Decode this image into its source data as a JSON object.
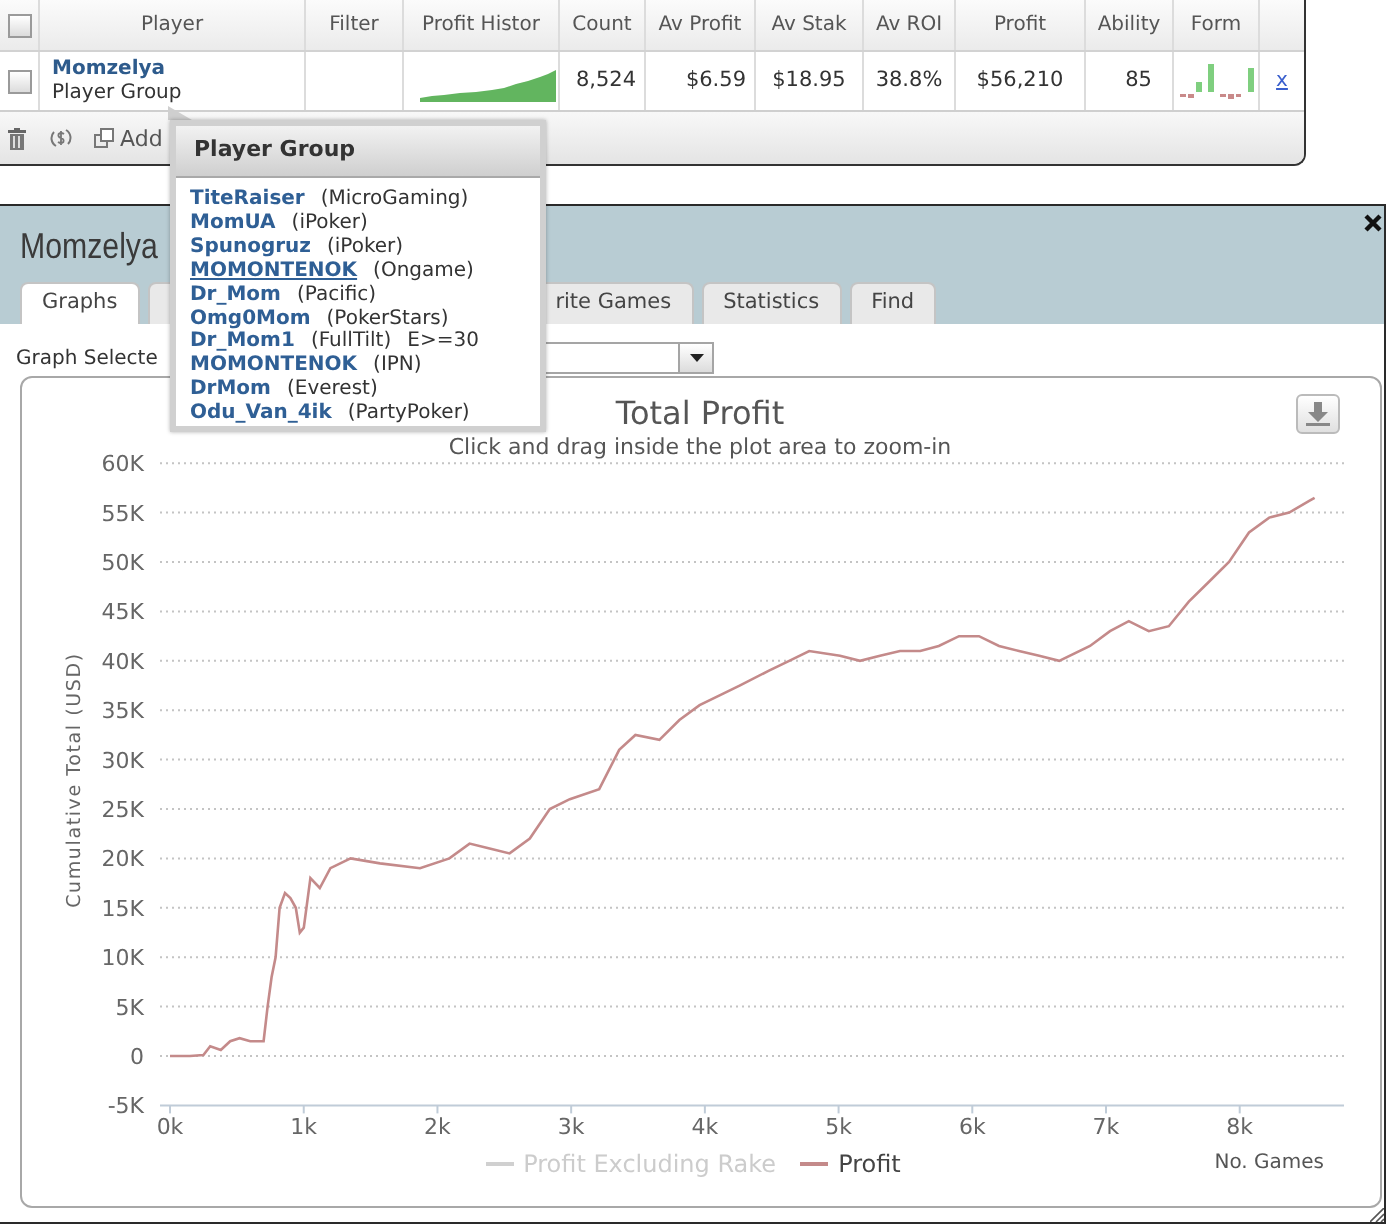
{
  "player_table": {
    "header_checked": false,
    "columns": [
      "Player",
      "Filter",
      "Profit Histor",
      "Count",
      "Av Profit",
      "Av Stak",
      "Av ROI",
      "Profit",
      "Ability",
      "Form"
    ],
    "rows": [
      {
        "checked": false,
        "player": "Momzelya",
        "group": "Player Group",
        "count": "8,524",
        "av_profit": "$6.59",
        "av_stake": "$18.95",
        "av_roi": "38.8%",
        "profit": "$56,210",
        "ability": "85",
        "remove": "x"
      }
    ]
  },
  "toolbar": {
    "add_label": "Add"
  },
  "player_group_popup": {
    "title": "Player Group",
    "members": [
      {
        "name": "TiteRaiser",
        "site": "(MicroGaming)",
        "hovered": false
      },
      {
        "name": "MomUA",
        "site": "(iPoker)",
        "hovered": false
      },
      {
        "name": "Spunogruz",
        "site": "(iPoker)",
        "hovered": false
      },
      {
        "name": "MOMONTENOK",
        "site": "(Ongame)",
        "hovered": true
      },
      {
        "name": "Dr_Mom",
        "site": "(Pacific)",
        "hovered": false
      },
      {
        "name": "Omg0Mom",
        "site": "(PokerStars)",
        "hovered": false
      },
      {
        "name": "Dr_Mom1",
        "site": "(FullTilt)",
        "note": "E>=30",
        "hovered": false
      },
      {
        "name": "MOMONTENOK",
        "site": "(IPN)",
        "hovered": false
      },
      {
        "name": "DrMom",
        "site": "(Everest)",
        "hovered": false
      },
      {
        "name": "Odu_Van_4ik",
        "site": "(PartyPoker)",
        "hovered": false
      }
    ]
  },
  "window": {
    "title": "Momzelya",
    "tabs": [
      {
        "label": "Graphs",
        "selected": true
      },
      {
        "selected": false
      },
      {
        "label": "rite Games",
        "selected": false
      },
      {
        "label": "Statistics",
        "selected": false
      },
      {
        "label": "Find",
        "selected": false
      }
    ],
    "graph_select": {
      "label": "Graph Selecte"
    },
    "chart": {
      "subtitle": "Click and drag inside the plot area to zoom-in",
      "legend": [
        {
          "visible": false
        },
        {
          "visible": true
        }
      ],
      "chart_data": {
        "type": "line",
        "title": "Total Profit",
        "xlabel": "No. Games",
        "ylabel": "Cumulative Total (USD)",
        "grid": true,
        "x": [
          0,
          150,
          250,
          300,
          380,
          450,
          520,
          600,
          700,
          730,
          760,
          790,
          820,
          860,
          900,
          940,
          970,
          1000,
          1050,
          1120,
          1200,
          1350,
          1570,
          1870,
          2090,
          2240,
          2390,
          2540,
          2690,
          2840,
          2990,
          3210,
          3360,
          3480,
          3660,
          3810,
          3960,
          4110,
          4260,
          4480,
          4630,
          4780,
          5010,
          5160,
          5310,
          5460,
          5610,
          5750,
          5900,
          6050,
          6200,
          6350,
          6500,
          6650,
          6880,
          7030,
          7170,
          7320,
          7470,
          7620,
          7770,
          7920,
          8070,
          8220,
          8370,
          8520,
          8560
        ],
        "series": [
          {
            "name": "Profit Excluding Rake",
            "values": [
              null,
              null,
              null,
              null,
              null,
              null,
              null,
              null,
              null,
              null,
              null,
              null,
              null,
              null,
              null,
              null,
              null,
              null,
              null,
              null,
              null,
              null,
              null,
              null,
              null,
              null,
              null,
              null,
              null,
              null,
              null,
              null,
              null,
              null,
              null,
              null,
              null,
              null,
              null,
              null,
              null,
              null,
              null,
              null,
              null,
              null,
              null,
              null,
              null,
              null,
              null,
              null,
              null,
              null,
              null,
              null,
              null,
              null,
              null,
              null,
              null,
              null,
              null,
              null,
              null,
              null,
              null
            ]
          },
          {
            "name": "Profit",
            "color": "#c48a8a",
            "values": [
              0,
              0,
              100,
              1000,
              600,
              1500,
              1800,
              1500,
              1500,
              5000,
              8000,
              10000,
              15000,
              16500,
              16000,
              15000,
              12500,
              13000,
              18000,
              17000,
              19000,
              20000,
              19500,
              19000,
              20000,
              21500,
              21000,
              20500,
              22000,
              25000,
              26000,
              27000,
              31000,
              32500,
              32000,
              34000,
              35500,
              36500,
              37500,
              39000,
              40000,
              41000,
              40500,
              40000,
              40500,
              41000,
              41000,
              41500,
              42500,
              42500,
              41500,
              41000,
              40500,
              40000,
              41500,
              43000,
              44000,
              43000,
              43500,
              46000,
              48000,
              50000,
              53000,
              54500,
              55000,
              56200,
              56500
            ]
          }
        ],
        "xlim": [
          -75,
          8780
        ],
        "ylim": [
          -5000,
          60000
        ],
        "xticks": [
          {
            "value": 0,
            "label": "0k"
          },
          {
            "value": 1000,
            "label": "1k"
          },
          {
            "value": 2000,
            "label": "2k"
          },
          {
            "value": 3000,
            "label": "3k"
          },
          {
            "value": 4000,
            "label": "4k"
          },
          {
            "value": 5000,
            "label": "5k"
          },
          {
            "value": 6000,
            "label": "6k"
          },
          {
            "value": 7000,
            "label": "7k"
          },
          {
            "value": 8000,
            "label": "8k"
          }
        ],
        "yticks": [
          {
            "value": -5000,
            "label": "-5K"
          },
          {
            "value": 0,
            "label": "0"
          },
          {
            "value": 5000,
            "label": "5K"
          },
          {
            "value": 10000,
            "label": "10K"
          },
          {
            "value": 15000,
            "label": "15K"
          },
          {
            "value": 20000,
            "label": "20K"
          },
          {
            "value": 25000,
            "label": "25K"
          },
          {
            "value": 30000,
            "label": "30K"
          },
          {
            "value": 35000,
            "label": "35K"
          },
          {
            "value": 40000,
            "label": "40K"
          },
          {
            "value": 45000,
            "label": "45K"
          },
          {
            "value": 50000,
            "label": "50K"
          },
          {
            "value": 55000,
            "label": "55K"
          },
          {
            "value": 60000,
            "label": "60K"
          }
        ]
      }
    }
  }
}
